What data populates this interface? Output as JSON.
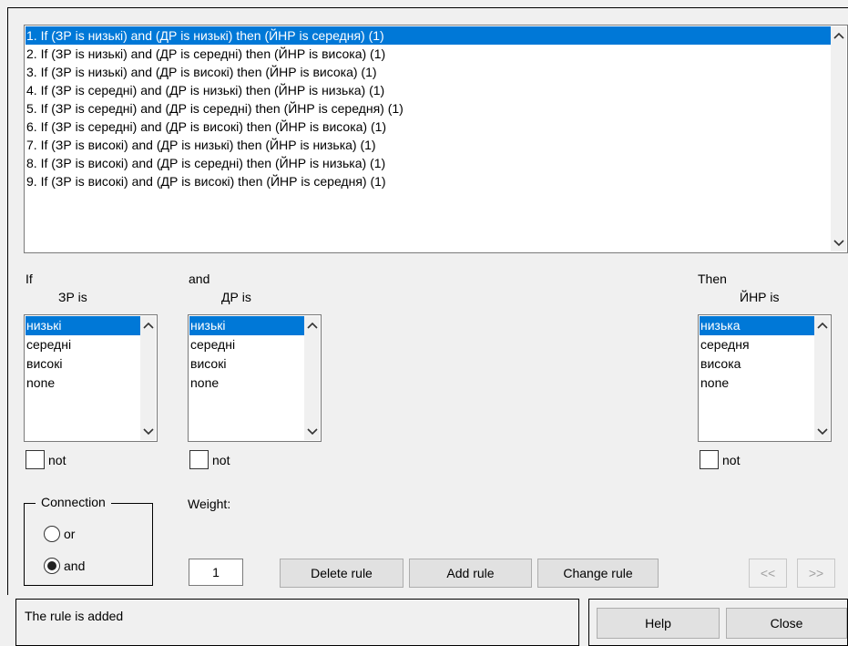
{
  "rules": [
    "1. If (ЗР is низькі) and (ДР is низькі) then (ЙНР is середня) (1)",
    "2. If (ЗР is низькі) and (ДР is середні) then (ЙНР is висока) (1)",
    "3. If (ЗР is низькі) and (ДР is високі) then (ЙНР is висока) (1)",
    "4. If (ЗР is середні) and (ДР is низькі) then (ЙНР is низька) (1)",
    "5. If (ЗР is середні) and (ДР is середні) then (ЙНР is середня) (1)",
    "6. If (ЗР is середні) and (ДР is високі) then (ЙНР is висока) (1)",
    "7. If (ЗР is високі) and (ДР is низькі) then (ЙНР is низька) (1)",
    "8. If (ЗР is високі) and (ДР is середні) then (ЙНР is низька) (1)",
    "9. If (ЗР is високі) and (ДР is високі) then (ЙНР is середня) (1)"
  ],
  "selected_rule_index": 0,
  "if_col": {
    "keyword": "If",
    "var_label": "ЗР is",
    "options": [
      "низькі",
      "середні",
      "високі",
      "none"
    ],
    "not_label": "not"
  },
  "and_col": {
    "keyword": "and",
    "var_label": "ДР is",
    "options": [
      "низькі",
      "середні",
      "високі",
      "none"
    ],
    "not_label": "not"
  },
  "then_col": {
    "keyword": "Then",
    "var_label": "ЙНР is",
    "options": [
      "низька",
      "середня",
      "висока",
      "none"
    ],
    "not_label": "not"
  },
  "connection": {
    "title": "Connection",
    "or_label": "or",
    "and_label": "and",
    "selected": "and"
  },
  "weight": {
    "label": "Weight:",
    "value": "1"
  },
  "buttons": {
    "delete_rule": "Delete rule",
    "add_rule": "Add rule",
    "change_rule": "Change rule",
    "prev": "<<",
    "next": ">>",
    "help": "Help",
    "close": "Close"
  },
  "status": "The rule is added",
  "icons": {
    "scroll_up": "chevron-up-icon",
    "scroll_down": "chevron-down-icon"
  }
}
